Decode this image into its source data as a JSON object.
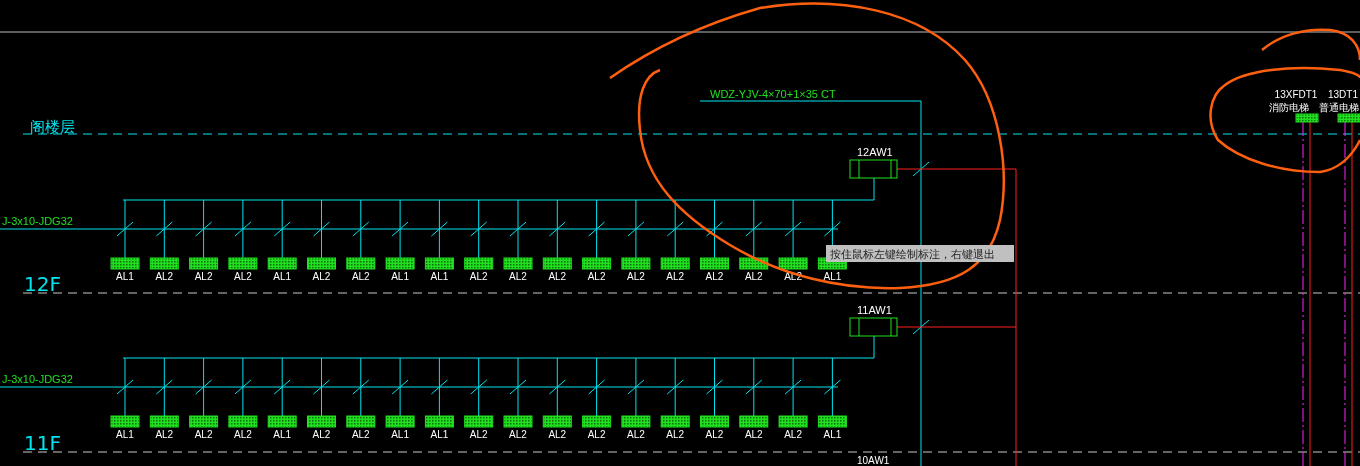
{
  "drawing": {
    "top_cable_label": "WDZ-YJV-4×70+1×35 CT",
    "levels": [
      {
        "label": "阁楼层"
      },
      {
        "label": "12F"
      },
      {
        "label": "11F"
      }
    ],
    "floors": [
      {
        "panel": "12AW1",
        "branch_cable": "J-3x10-JDG32",
        "boxes": [
          "AL1",
          "AL2",
          "AL2",
          "AL2",
          "AL1",
          "AL2",
          "AL2",
          "AL1",
          "AL1",
          "AL2",
          "AL2",
          "AL2",
          "AL2",
          "AL2",
          "AL2",
          "AL2",
          "AL2",
          "AL2",
          "AL1"
        ]
      },
      {
        "panel": "11AW1",
        "branch_cable": "J-3x10-JDG32",
        "boxes": [
          "AL1",
          "AL2",
          "AL2",
          "AL2",
          "AL1",
          "AL2",
          "AL2",
          "AL1",
          "AL1",
          "AL2",
          "AL2",
          "AL2",
          "AL2",
          "AL2",
          "AL2",
          "AL2",
          "AL2",
          "AL2",
          "AL1"
        ]
      }
    ],
    "next_panel": "10AW1",
    "elevators": [
      {
        "code": "13XFDT1",
        "name": "消防电梯"
      },
      {
        "code": "13DT1",
        "name": "普通电梯"
      }
    ]
  },
  "tooltip": "按住鼠标左键绘制标注，右键退出"
}
